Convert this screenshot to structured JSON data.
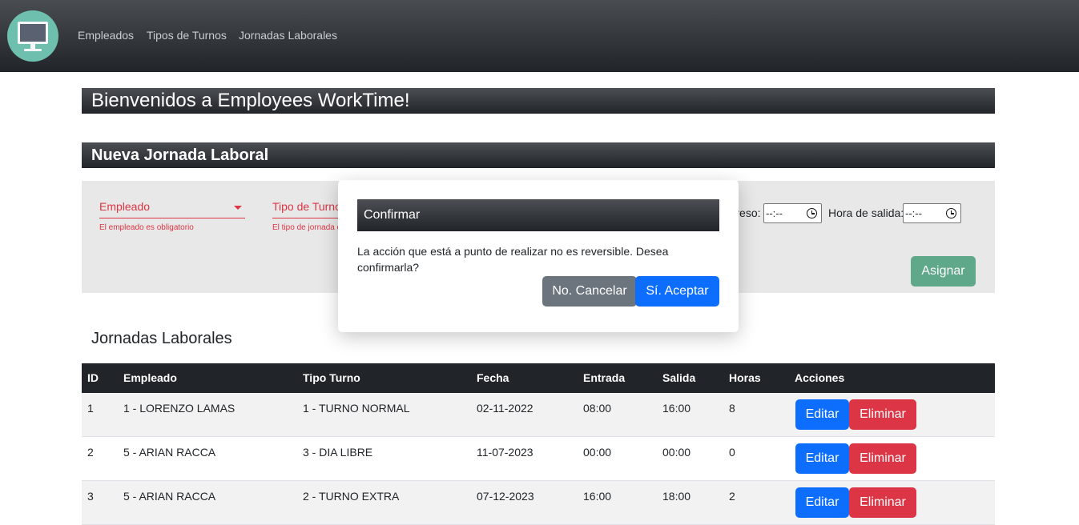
{
  "nav": {
    "items": [
      {
        "label": "Empleados"
      },
      {
        "label": "Tipos de Turnos"
      },
      {
        "label": "Jornadas Laborales"
      }
    ]
  },
  "welcome_title": "Bienvenidos a Employees WorkTime!",
  "form": {
    "title": "Nueva Jornada Laboral",
    "empleado_label": "Empleado",
    "empleado_error": "El empleado es obligatorio",
    "tipo_turno_label": "Tipo de Turno",
    "tipo_turno_error": "El tipo de jornada es obligatorio",
    "hora_ingreso_label": "Hora de ingreso:",
    "hora_ingreso_value": "--:--",
    "hora_salida_label": "Hora de salida:",
    "hora_salida_value": "--:--",
    "assign_label": "Asignar"
  },
  "list_title": "Jornadas Laborales",
  "table": {
    "headers": [
      "ID",
      "Empleado",
      "Tipo Turno",
      "Fecha",
      "Entrada",
      "Salida",
      "Horas",
      "Acciones"
    ],
    "rows": [
      {
        "id": "1",
        "empleado": "1 - LORENZO LAMAS",
        "tipo": "1 - TURNO NORMAL",
        "fecha": "02-11-2022",
        "entrada": "08:00",
        "salida": "16:00",
        "horas": "8"
      },
      {
        "id": "2",
        "empleado": "5 - ARIAN RACCA",
        "tipo": "3 - DIA LIBRE",
        "fecha": "11-07-2023",
        "entrada": "00:00",
        "salida": "00:00",
        "horas": "0"
      },
      {
        "id": "3",
        "empleado": "5 - ARIAN RACCA",
        "tipo": "2 - TURNO EXTRA",
        "fecha": "07-12-2023",
        "entrada": "16:00",
        "salida": "18:00",
        "horas": "2"
      }
    ],
    "edit_label": "Editar",
    "delete_label": "Eliminar"
  },
  "modal": {
    "title": "Confirmar",
    "message": "La acción que está a punto de realizar no es reversible. Desea confirmarla?",
    "cancel_label": "No. Cancelar",
    "accept_label": "Sí. Aceptar"
  },
  "colors": {
    "nav_bg": "#212529",
    "logo_bg": "#6ebfae",
    "error": "#dc3545",
    "primary": "#0d6efd",
    "secondary": "#6c757d",
    "success_muted": "#5fa88a"
  },
  "icons": {
    "logo": "monitor-icon",
    "select_caret": "caret-down-icon",
    "time": "clock-icon"
  }
}
